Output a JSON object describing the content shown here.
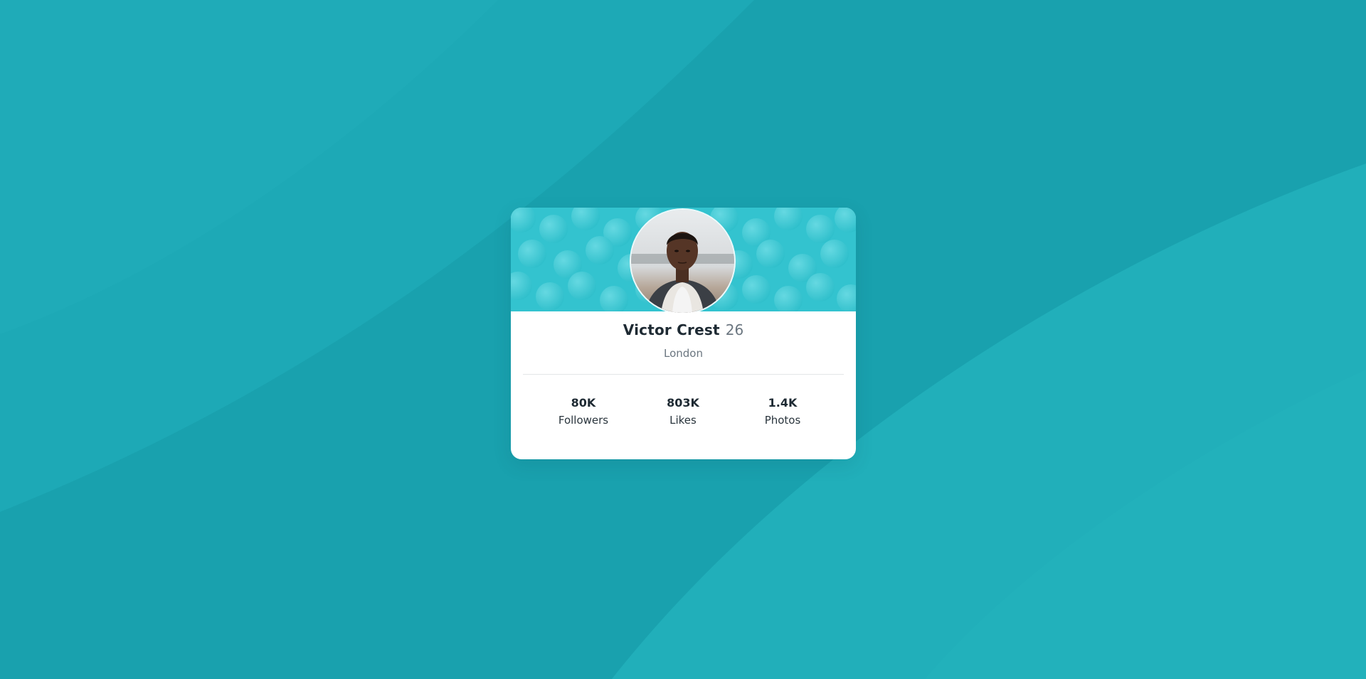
{
  "theme": {
    "background": "#19a1ae",
    "background_light": "#22b1bc",
    "banner": "#33c3cf",
    "card": "#ffffff",
    "text_primary": "#1e2a33",
    "text_secondary": "#6b7680"
  },
  "profile": {
    "name": "Victor Crest",
    "age": "26",
    "city": "London",
    "avatar_icon": "profile-photo"
  },
  "stats": [
    {
      "value": "80K",
      "label": "Followers"
    },
    {
      "value": "803K",
      "label": "Likes"
    },
    {
      "value": "1.4K",
      "label": "Photos"
    }
  ]
}
